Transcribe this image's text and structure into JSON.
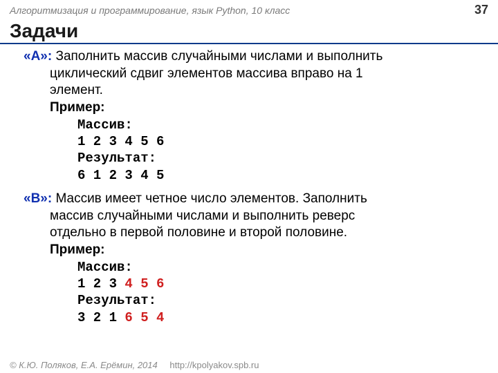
{
  "header": {
    "left": "Алгоритмизация и программирование, язык Python, 10 класс",
    "page": "37"
  },
  "title": "Задачи",
  "tasks": {
    "a": {
      "label": "«A»:",
      "text1": " Заполнить массив случайными числами и выполнить",
      "text2": "циклический сдвиг элементов массива вправо на 1",
      "text3": "элемент.",
      "example_label": "Пример:",
      "arr_label": "Массив:",
      "arr_values": "1 2 3 4 5 6",
      "res_label": "Результат:",
      "res_values": "6 1 2 3 4 5"
    },
    "b": {
      "label": "«B»:",
      "text1": " Массив имеет четное число элементов. Заполнить",
      "text2": "массив случайными числами и выполнить реверс",
      "text3": "отдельно в первой половине и второй половине.",
      "example_label": "Пример:",
      "arr_label": "Массив:",
      "arr_part1": "1 2 3 ",
      "arr_part2": "4 5 6",
      "res_label": "Результат:",
      "res_part1": "3 2 1 ",
      "res_part2": "6 5 4"
    }
  },
  "footer": {
    "credits": "© К.Ю. Поляков, Е.А. Ерёмин, 2014",
    "url": "http://kpolyakov.spb.ru"
  }
}
